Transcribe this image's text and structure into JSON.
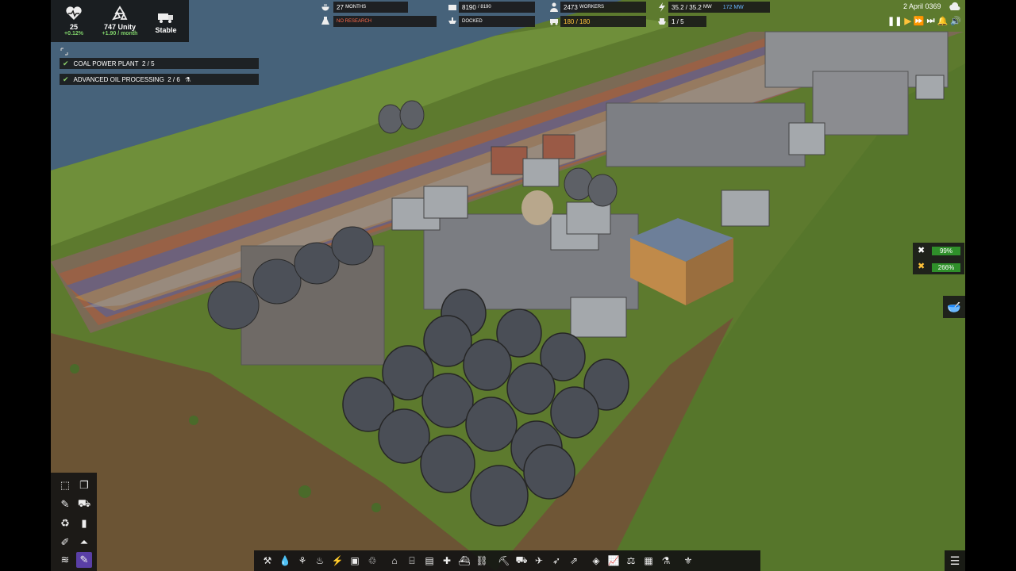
{
  "stats": {
    "health": {
      "value": "25",
      "delta": "+0.12%",
      "icon": "heart-pulse-icon"
    },
    "unity": {
      "value": "747 Unity",
      "delta": "+1.90 / month",
      "icon": "recycle-icon"
    },
    "status": {
      "value": "Stable",
      "icon": "truck-icon"
    }
  },
  "topbar": {
    "months": {
      "value": "27",
      "unit": "MONTHS"
    },
    "research": "NO RESEARCH",
    "storage": {
      "value": "8190",
      "max": "/ 8190"
    },
    "docked": "DOCKED",
    "workers": {
      "value": "2473",
      "unit": "WORKERS"
    },
    "vehicles": "180 / 180",
    "power": {
      "value": "35.2 / 35.2",
      "unit": "MW",
      "extra": "172 MW"
    },
    "ships": "1 / 5",
    "date": "2 April 0369"
  },
  "goals": [
    {
      "label": "COAL POWER PLANT",
      "progress": "2 / 5"
    },
    {
      "label": "ADVANCED OIL PROCESSING",
      "progress": "2 / 6"
    }
  ],
  "maintenance": {
    "first": "99%",
    "second": "266%"
  },
  "colors": {
    "accent": "#2f8f2a",
    "warning": "#ffc23a",
    "danger": "#ff6a4a"
  }
}
